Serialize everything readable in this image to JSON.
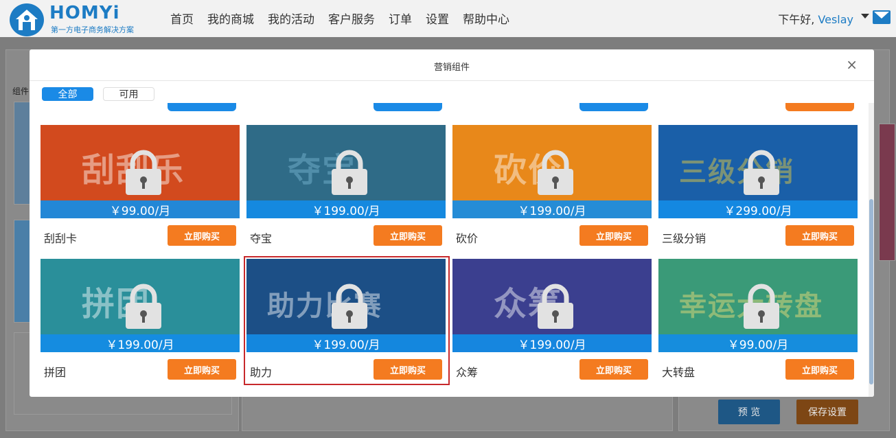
{
  "header": {
    "logo_text": "HOMYi",
    "logo_subtitle": "第一方电子商务解决方案",
    "nav": [
      "首页",
      "我的商城",
      "我的活动",
      "客户服务",
      "订单",
      "设置",
      "帮助中心"
    ],
    "greeting": "下午好,",
    "username": "Veslay"
  },
  "background": {
    "side_label": "组件",
    "preview_label": "预 览",
    "save_label": "保存设置"
  },
  "modal": {
    "title": "营销组件",
    "close": "×",
    "tabs": [
      {
        "label": "全部",
        "active": true
      },
      {
        "label": "可用",
        "active": false
      }
    ],
    "partial_colors": [
      "#1a8ae6",
      "#1a8ae6",
      "#1a8ae6",
      "#f47b20"
    ],
    "cards": [
      {
        "name": "刮刮卡",
        "price": "￥99.00/月",
        "button": "立即购买",
        "bg": "#d24a1e",
        "deco": "刮刮乐",
        "deco_color": "#fff",
        "selected": false
      },
      {
        "name": "夺宝",
        "price": "￥199.00/月",
        "button": "立即购买",
        "bg": "#2f6b87",
        "deco": "夺宝",
        "deco_color": "#7bb9d6",
        "selected": false
      },
      {
        "name": "砍价",
        "price": "￥199.00/月",
        "button": "立即购买",
        "bg": "#e8881a",
        "deco": "砍价",
        "deco_color": "#fff",
        "selected": false
      },
      {
        "name": "三级分销",
        "price": "￥299.00/月",
        "button": "立即购买",
        "bg": "#1a5fa8",
        "deco": "三级分销",
        "deco_color": "#f3d23a",
        "selected": false
      },
      {
        "name": "拼团",
        "price": "￥199.00/月",
        "button": "立即购买",
        "bg": "#2a8f9a",
        "deco": "拼团",
        "deco_color": "#fff",
        "selected": false
      },
      {
        "name": "助力",
        "price": "￥199.00/月",
        "button": "立即购买",
        "bg": "#1c4f86",
        "deco": "助力比赛",
        "deco_color": "#fff",
        "selected": true
      },
      {
        "name": "众筹",
        "price": "￥199.00/月",
        "button": "立即购买",
        "bg": "#3b3f8f",
        "deco": "众筹",
        "deco_color": "#fff",
        "selected": false
      },
      {
        "name": "大转盘",
        "price": "￥99.00/月",
        "button": "立即购买",
        "bg": "#3a9a78",
        "deco": "幸运大转盘",
        "deco_color": "#f6e27a",
        "selected": false
      }
    ]
  }
}
